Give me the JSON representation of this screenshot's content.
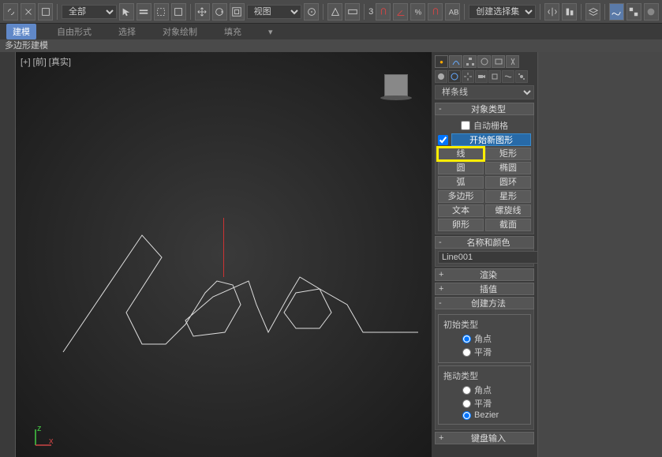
{
  "toolbar": {
    "filter_label": "全部",
    "view_label": "视图",
    "select_set_label": "创建选择集",
    "numeric_label": "3"
  },
  "tabs": [
    "建模",
    "自由形式",
    "选择",
    "对象绘制",
    "填充"
  ],
  "active_tab_index": 0,
  "module_label": "多边形建模",
  "viewport": {
    "label": "[+] [前] [真实]"
  },
  "command_panel": {
    "type_dropdown": "样条线",
    "rollouts": {
      "object_type": {
        "title": "对象类型",
        "auto_grid_label": "自动栅格",
        "start_new_label": "开始新图形",
        "buttons": [
          [
            "线",
            "矩形"
          ],
          [
            "圆",
            "椭圆"
          ],
          [
            "弧",
            "圆环"
          ],
          [
            "多边形",
            "星形"
          ],
          [
            "文本",
            "螺旋线"
          ],
          [
            "卵形",
            "截面"
          ]
        ],
        "highlighted": "线"
      },
      "name_color": {
        "title": "名称和颜色",
        "value": "Line001"
      },
      "render": {
        "title": "渲染"
      },
      "interpolation": {
        "title": "插值"
      },
      "creation_method": {
        "title": "创建方法",
        "initial_label": "初始类型",
        "drag_label": "拖动类型",
        "options_initial": [
          "角点",
          "平滑"
        ],
        "options_drag": [
          "角点",
          "平滑",
          "Bezier"
        ]
      },
      "keyboard": {
        "title": "键盘输入"
      }
    }
  }
}
